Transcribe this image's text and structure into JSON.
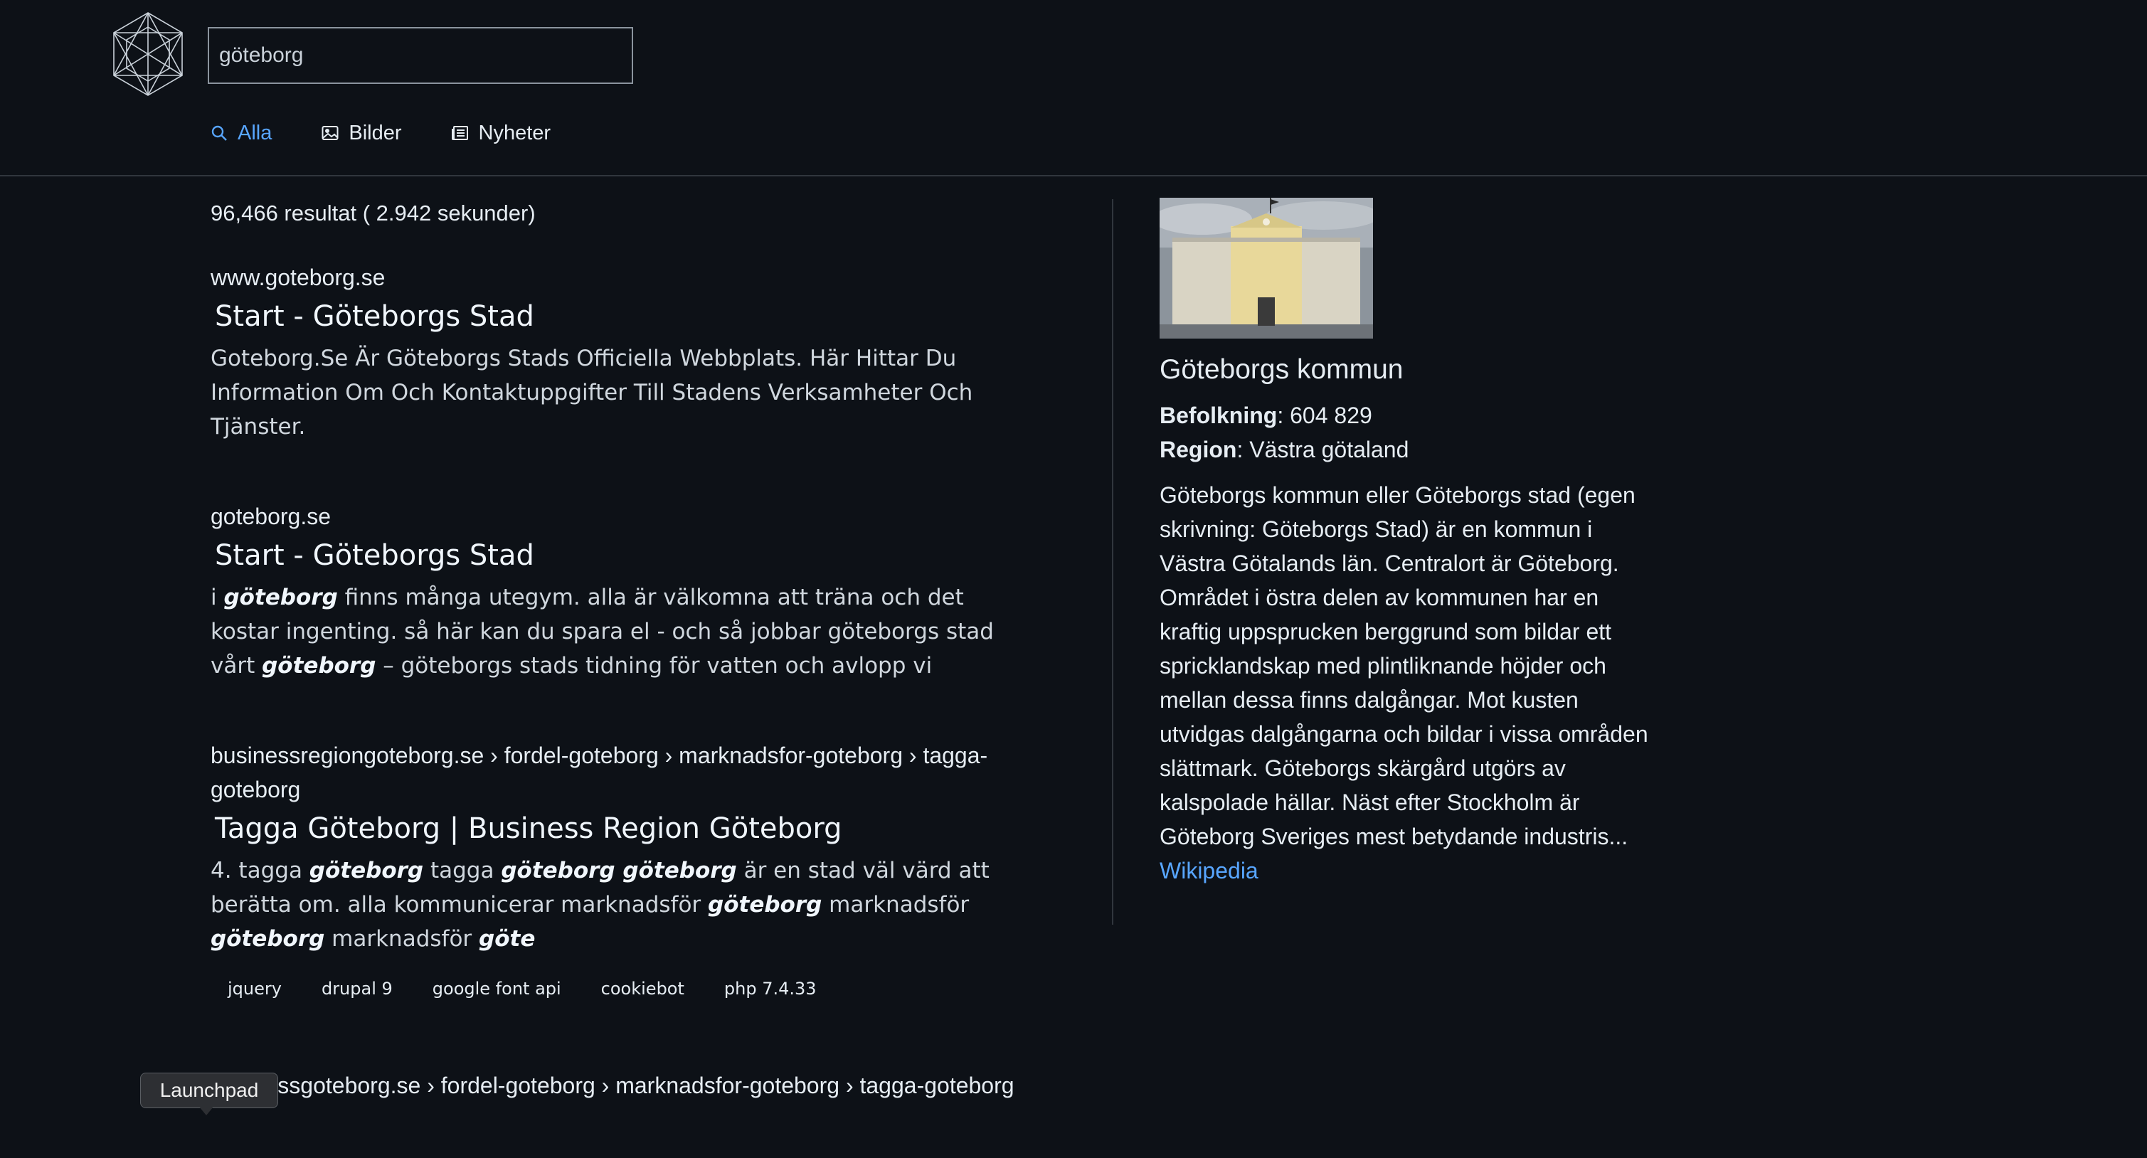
{
  "search": {
    "query": "göteborg"
  },
  "tabs": [
    {
      "label": "Alla",
      "icon": "search-icon",
      "active": true
    },
    {
      "label": "Bilder",
      "icon": "image-icon"
    },
    {
      "label": "Nyheter",
      "icon": "newspaper-icon"
    }
  ],
  "stats": {
    "count_text": "96,466 resultat ( 2.942 sekunder)"
  },
  "results": [
    {
      "url": "www.goteborg.se",
      "title": "Start - Göteborgs Stad",
      "snippet": "Goteborg.Se Är Göteborgs Stads Officiella Webbplats. Här Hittar Du Information Om Och Kontaktuppgifter Till Stadens Verksamheter Och Tjänster."
    },
    {
      "url": "goteborg.se",
      "title": "Start - Göteborgs Stad",
      "snippet_parts": [
        {
          "t": "i "
        },
        {
          "t": "göteborg",
          "b": true
        },
        {
          "t": " finns många utegym. alla är välkomna att träna och det kostar ingenting. så här kan du spara el - och så jobbar göteborgs stad vårt "
        },
        {
          "t": "göteborg",
          "b": true
        },
        {
          "t": " – göteborgs stads tidning för vatten och avlopp vi"
        }
      ]
    },
    {
      "url": "businessregiongoteborg.se › fordel-goteborg › marknadsfor-goteborg › tagga-goteborg",
      "title": "Tagga Göteborg | Business Region Göteborg",
      "snippet_parts": [
        {
          "t": "4. tagga "
        },
        {
          "t": "göteborg",
          "b": true
        },
        {
          "t": " tagga "
        },
        {
          "t": "göteborg göteborg",
          "b": true
        },
        {
          "t": " är en stad väl värd att berätta om. alla kommunicerar marknadsför "
        },
        {
          "t": "göteborg",
          "b": true
        },
        {
          "t": " marknadsför "
        },
        {
          "t": "göteborg",
          "b": true
        },
        {
          "t": " marknadsför "
        },
        {
          "t": "göte",
          "b": true
        }
      ],
      "tags": [
        "jquery",
        "drupal 9",
        "google font api",
        "cookiebot",
        "php 7.4.33"
      ]
    },
    {
      "url": "businessgoteborg.se › fordel-goteborg › marknadsfor-goteborg › tagga-goteborg"
    }
  ],
  "panel": {
    "title": "Göteborgs kommun",
    "facts": [
      {
        "label": "Befolkning",
        "value": ": 604 829"
      },
      {
        "label": "Region",
        "value": ": Västra götaland"
      }
    ],
    "description": "Göteborgs kommun eller Göteborgs stad (egen skrivning: Göteborgs Stad) är en kommun i Västra Götalands län. Centralort är Göteborg. Området i östra delen av kommunen har en kraftig uppsprucken berggrund som bildar ett spricklandskap med plintliknande höjder och mellan dessa finns dalgångar. Mot kusten utvidgas dalgångarna och bildar i vissa områden slättmark. Göteborgs skärgård utgörs av kalspolade hällar. Näst efter Stockholm är Göteborg Sveriges mest betydande industris...",
    "source": "Wikipedia"
  },
  "tooltip": {
    "text": "Launchpad"
  },
  "colors": {
    "background": "#0d1117",
    "accent": "#58a6ff",
    "border": "#30363d"
  }
}
